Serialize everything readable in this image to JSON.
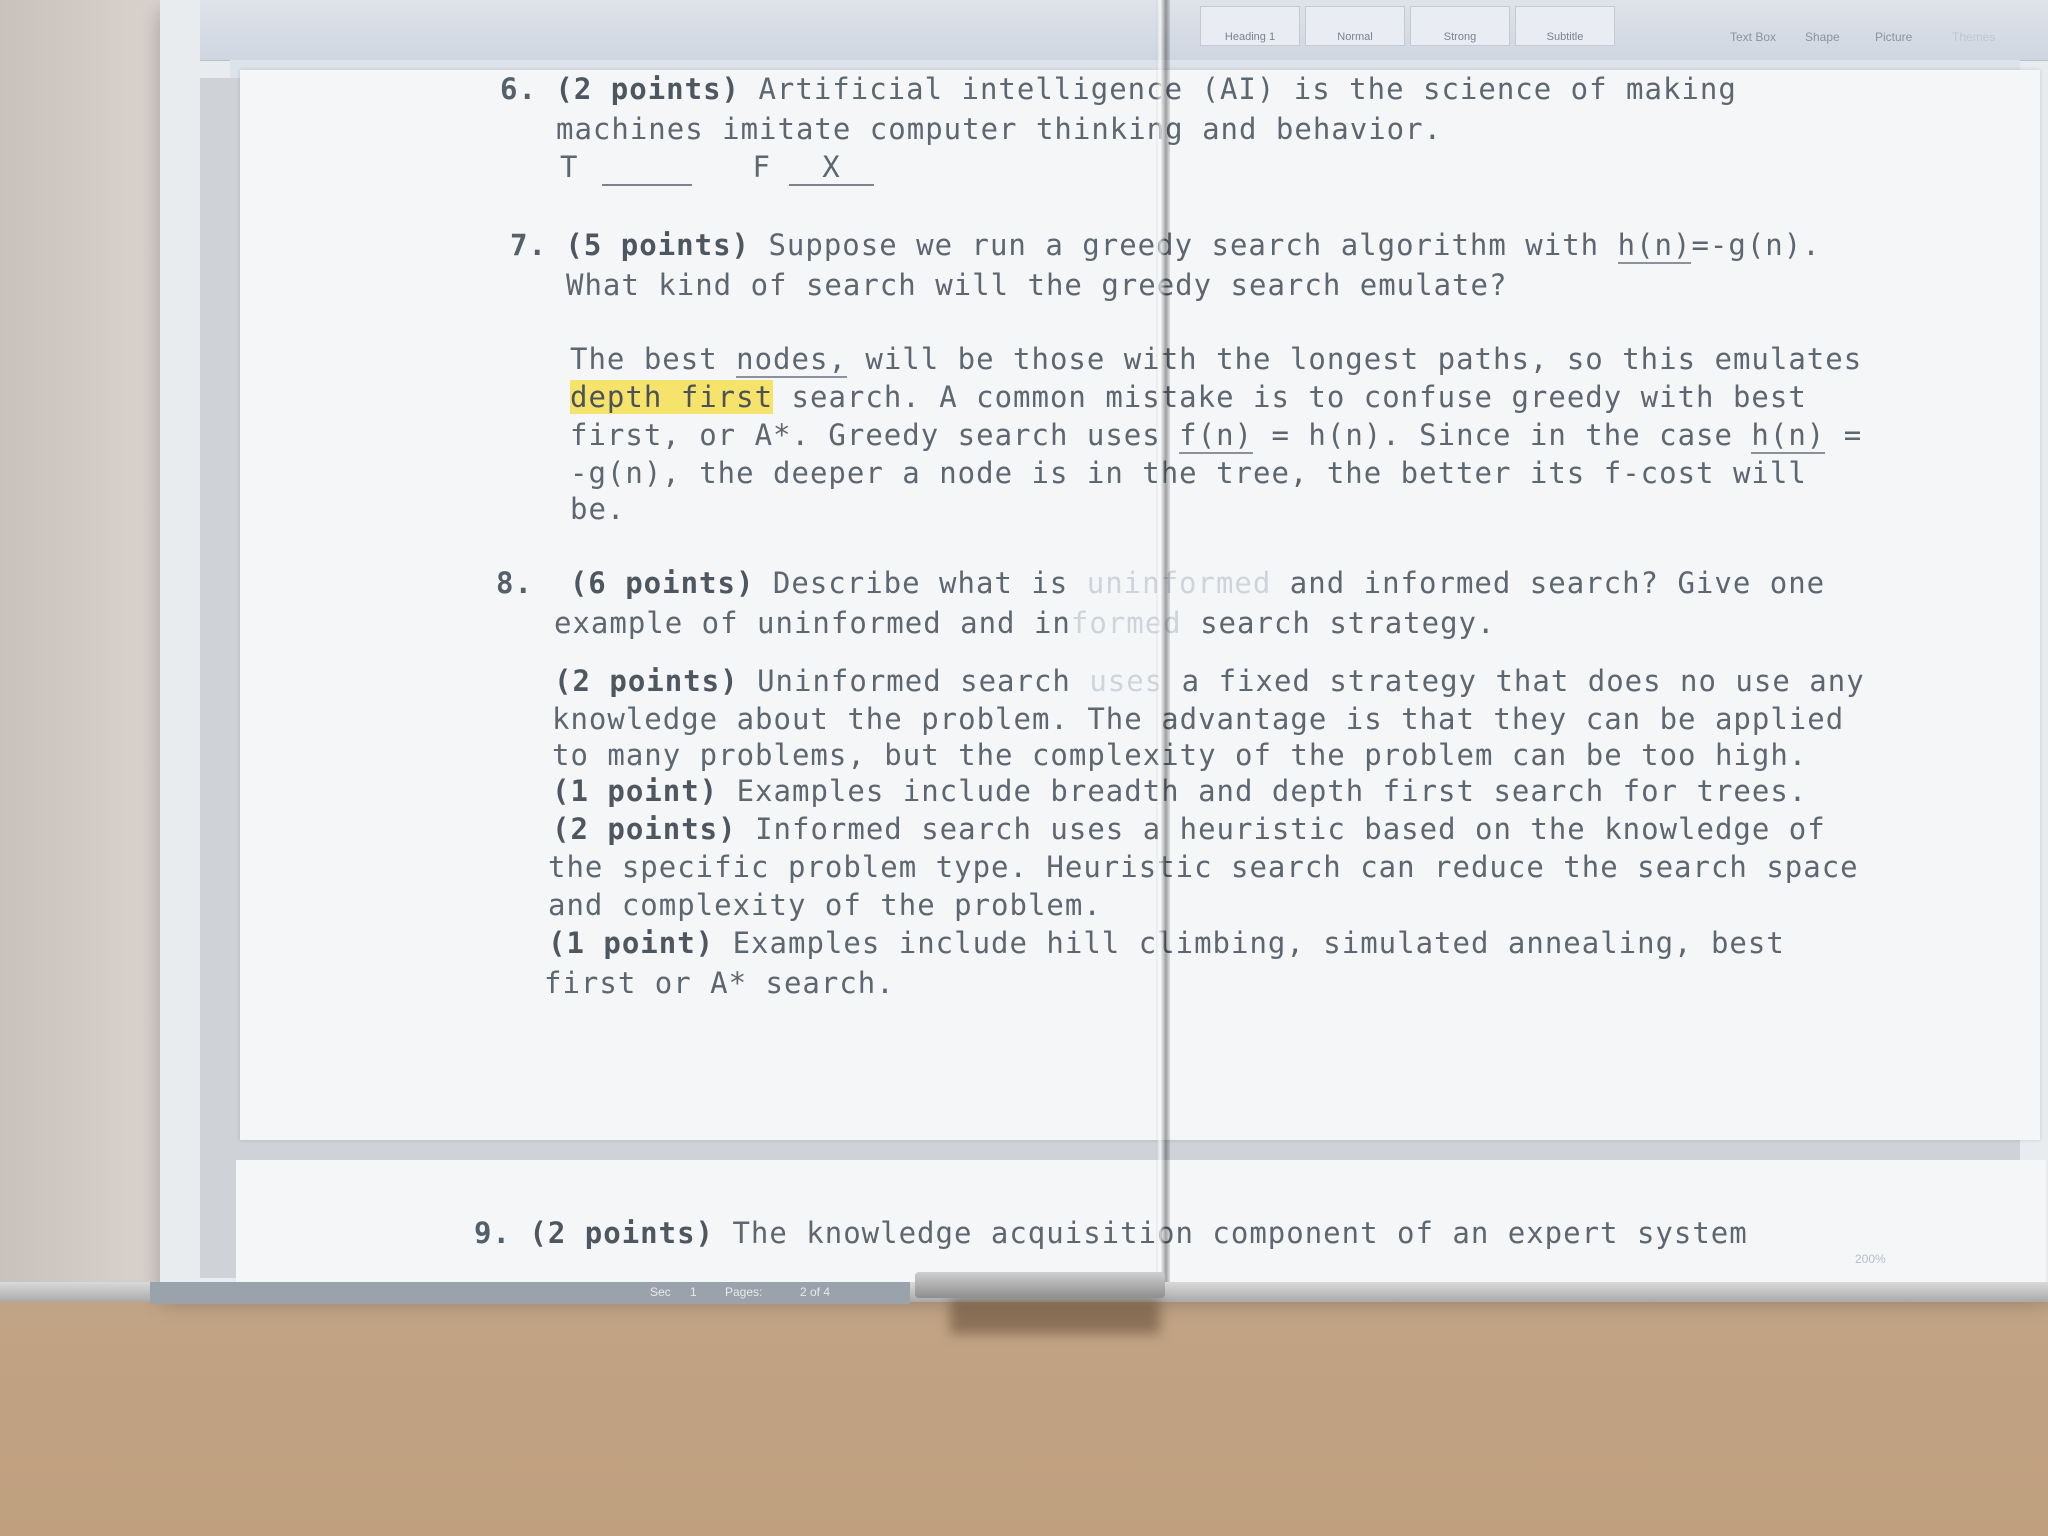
{
  "ribbon": {
    "styles": [
      "Heading 1",
      "Normal",
      "Strong",
      "Subtitle"
    ],
    "tools": [
      "Text Box",
      "Shape",
      "Picture",
      "Themes"
    ]
  },
  "status_bar": {
    "sec_label": "Sec",
    "sec_value": "1",
    "pages_label": "Pages:",
    "pages_value": "2 of 4",
    "zoom": "200%"
  },
  "document": {
    "q6": {
      "number": "6.",
      "points": "(2 points)",
      "line1": " Artificial intelligence (AI) is the science of making",
      "line2": "machines imitate computer thinking and behavior.",
      "t_label": "T",
      "f_label": "F",
      "f_answer": "X"
    },
    "q7": {
      "number": "7.",
      "points": "(5 points)",
      "line1_pre": " Suppose we run a greedy search algorithm with ",
      "line1_hn": "h(n)",
      "line1_post": "=-g(n).",
      "line2": "What kind of search will the greedy search emulate?",
      "ans1_pre": "The best ",
      "ans1_ul": "nodes,",
      "ans1_post": " will be those with the longest paths, so this emulates",
      "ans2_hl": "depth first",
      "ans2_post": " search. A common mistake is to confuse greedy with best",
      "ans3_pre": "first, or A*. Greedy search uses ",
      "ans3_fn": "f(n)",
      "ans3_mid": " = h(n). Since in the case ",
      "ans3_hn": "h(n)",
      "ans3_post": " =",
      "ans4": "-g(n), the deeper a node is in the tree, the better its f-cost will",
      "ans5": "be."
    },
    "q8": {
      "number": "8.",
      "points": "(6 points)",
      "line1_pre": " Describe what is ",
      "line1_faint": "uninformed",
      "line1_post": " and informed search? Give one",
      "line2_pre": "example of uninformed and in",
      "line2_faint": "formed",
      "line2_post": " search strategy.",
      "a1_pts": "(2 points)",
      "a1_line1_pre": " Uninformed search ",
      "a1_line1_faint": "uses",
      "a1_line1_post": " a fixed strategy that does no use any",
      "a1_line2": "knowledge about the problem. The advantage is that they can be applied",
      "a1_line3": "to many problems, but the complexity of the problem can be too high.",
      "a2_pts": "(1 point)",
      "a2_line1": " Examples include breadth and depth first search for trees.",
      "a3_pts": "(2 points)",
      "a3_line1": " Informed search uses a heuristic based on the knowledge of",
      "a3_line2": "the specific problem type. Heuristic search can reduce the search space",
      "a3_line3": "and complexity of the problem.",
      "a4_pts": "(1 point)",
      "a4_line1": " Examples include hill climbing, simulated annealing, best",
      "a4_line2": "first or A* search."
    },
    "q9": {
      "number": "9.",
      "points": "(2 points)",
      "line1": " The knowledge acquisition component of an expert system"
    }
  }
}
